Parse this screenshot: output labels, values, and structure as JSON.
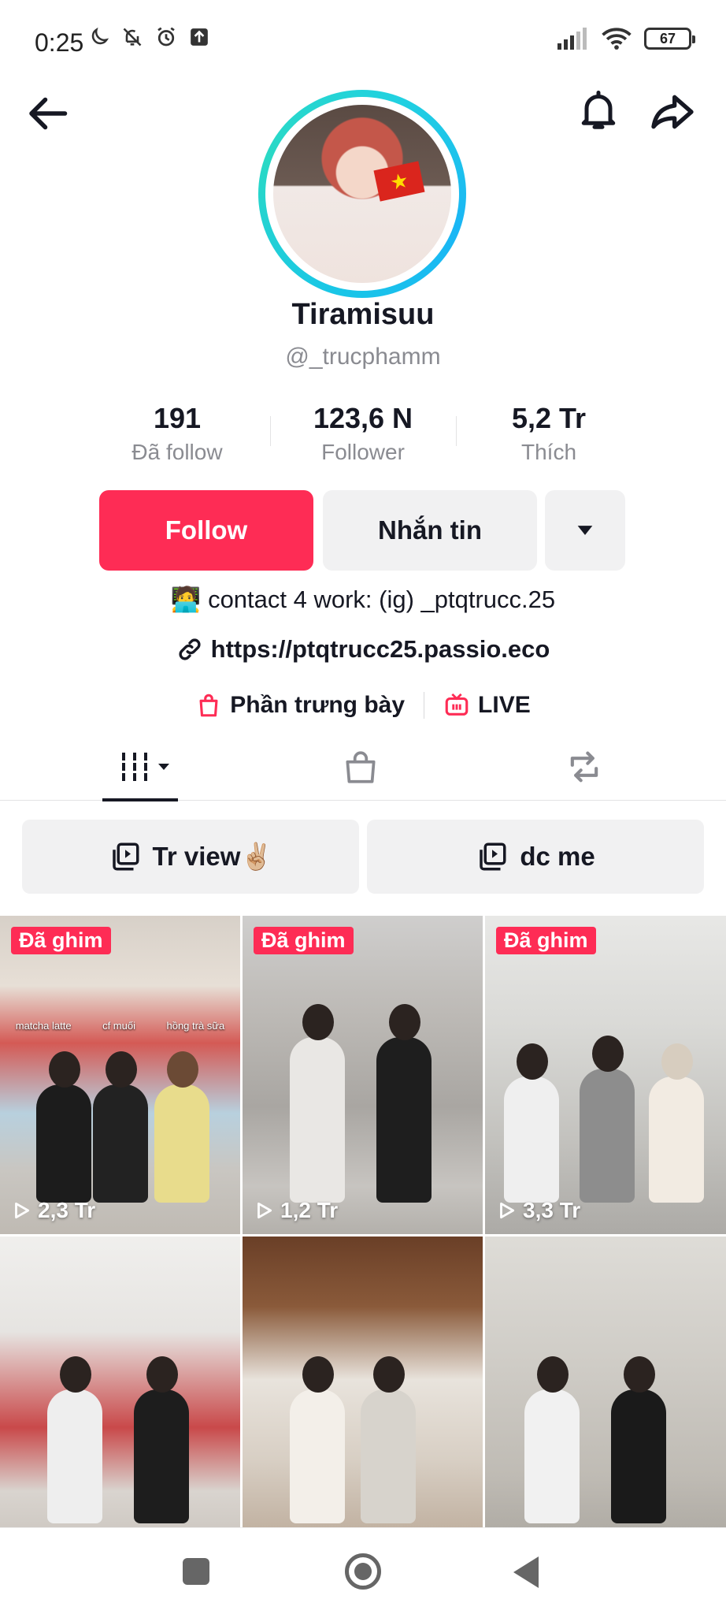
{
  "status_bar": {
    "time": "0:25",
    "battery": "67",
    "left_icons": [
      "moon-icon",
      "bell-off-icon",
      "alarm-icon",
      "upload-icon"
    ],
    "right_icons": [
      "signal-icon",
      "wifi-icon",
      "battery-icon"
    ]
  },
  "profile": {
    "display_name": "Tiramisuu",
    "username": "@_trucphamm",
    "stats": [
      {
        "value": "191",
        "label": "Đã follow"
      },
      {
        "value": "123,6 N",
        "label": "Follower"
      },
      {
        "value": "5,2 Tr",
        "label": "Thích"
      }
    ],
    "follow_label": "Follow",
    "message_label": "Nhắn tin",
    "bio_emoji": "🧑‍💻",
    "bio": "contact 4 work: (ig) _ptqtrucc.25",
    "link": "https://ptqtrucc25.passio.eco",
    "showcase_label": "Phần trưng bày",
    "live_label": "LIVE"
  },
  "colors": {
    "accent": "#fe2c55",
    "text": "#161823",
    "muted": "#8a8b91",
    "button_gray": "#f1f1f2",
    "avatar_ring": "#19c7e6"
  },
  "tabs": [
    {
      "name": "videos",
      "icon": "grid-icon",
      "active": true
    },
    {
      "name": "shop",
      "icon": "shopping-bag-icon",
      "active": false
    },
    {
      "name": "reposts",
      "icon": "repost-icon",
      "active": false
    }
  ],
  "playlists": [
    {
      "label": "Tr view✌🏼"
    },
    {
      "label": "dc me"
    }
  ],
  "videos": [
    {
      "pinned_label": "Đã ghim",
      "views": "2,3 Tr",
      "overlay": [
        "matcha latte",
        "cf muối",
        "hồng trà sữa"
      ]
    },
    {
      "pinned_label": "Đã ghim",
      "views": "1,2 Tr"
    },
    {
      "pinned_label": "Đã ghim",
      "views": "3,3 Tr"
    },
    {},
    {},
    {}
  ]
}
